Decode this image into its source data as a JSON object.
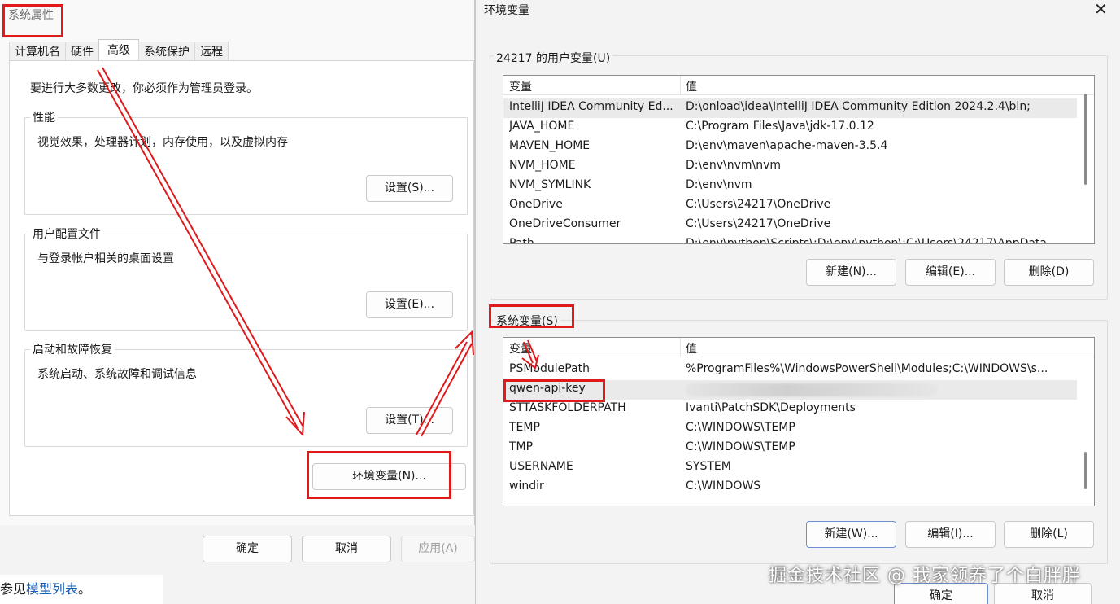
{
  "background": {
    "see_prefix": "参见",
    "link": "模型列表",
    "suffix": "。"
  },
  "system_properties": {
    "title": "系统属性",
    "tabs": [
      "计算机名",
      "硬件",
      "高级",
      "系统保护",
      "远程"
    ],
    "active_tab": "高级",
    "admin_note": "要进行大多数更改，你必须作为管理员登录。",
    "performance": {
      "label": "性能",
      "desc": "视觉效果，处理器计划，内存使用，以及虚拟内存",
      "button": "设置(S)..."
    },
    "user_profiles": {
      "label": "用户配置文件",
      "desc": "与登录帐户相关的桌面设置",
      "button": "设置(E)..."
    },
    "startup_recovery": {
      "label": "启动和故障恢复",
      "desc": "系统启动、系统故障和调试信息",
      "button": "设置(T)..."
    },
    "env_button": "环境变量(N)...",
    "ok": "确定",
    "cancel": "取消",
    "apply": "应用(A)"
  },
  "env_vars": {
    "title": "环境变量",
    "close_glyph": "✕",
    "user_section_label": "24217 的用户变量(U)",
    "col_variable": "变量",
    "col_value": "值",
    "user_rows": [
      {
        "name": "IntelliJ IDEA Community Ed...",
        "value": "D:\\onload\\idea\\IntelliJ IDEA Community Edition 2024.2.4\\bin;"
      },
      {
        "name": "JAVA_HOME",
        "value": "C:\\Program Files\\Java\\jdk-17.0.12"
      },
      {
        "name": "MAVEN_HOME",
        "value": "D:\\env\\maven\\apache-maven-3.5.4"
      },
      {
        "name": "NVM_HOME",
        "value": "D:\\env\\nvm\\nvm"
      },
      {
        "name": "NVM_SYMLINK",
        "value": "D:\\env\\nvm"
      },
      {
        "name": "OneDrive",
        "value": "C:\\Users\\24217\\OneDrive"
      },
      {
        "name": "OneDriveConsumer",
        "value": "C:\\Users\\24217\\OneDrive"
      },
      {
        "name": "Path",
        "value": "D:\\env\\python\\Scripts\\;D:\\env\\python\\;C:\\Users\\24217\\AppData..."
      }
    ],
    "user_new": "新建(N)...",
    "user_edit": "编辑(E)...",
    "user_delete": "删除(D)",
    "system_section_label": "系统变量(S)",
    "system_rows": [
      {
        "name": "PSModulePath",
        "value": "%ProgramFiles%\\WindowsPowerShell\\Modules;C:\\WINDOWS\\s..."
      },
      {
        "name": "qwen-api-key",
        "value": ""
      },
      {
        "name": "STTASKFOLDERPATH",
        "value": "Ivanti\\PatchSDK\\Deployments"
      },
      {
        "name": "TEMP",
        "value": "C:\\WINDOWS\\TEMP"
      },
      {
        "name": "TMP",
        "value": "C:\\WINDOWS\\TEMP"
      },
      {
        "name": "USERNAME",
        "value": "SYSTEM"
      },
      {
        "name": "windir",
        "value": "C:\\WINDOWS"
      }
    ],
    "sys_new": "新建(W)...",
    "sys_edit": "编辑(I)...",
    "sys_delete": "删除(L)",
    "ok": "确定",
    "cancel": "取消"
  },
  "watermark": "掘金技术社区 @ 我家领养了个白胖胖",
  "colors": {
    "annotation_red": "#e0191b",
    "link_blue": "#1a5fb4"
  }
}
